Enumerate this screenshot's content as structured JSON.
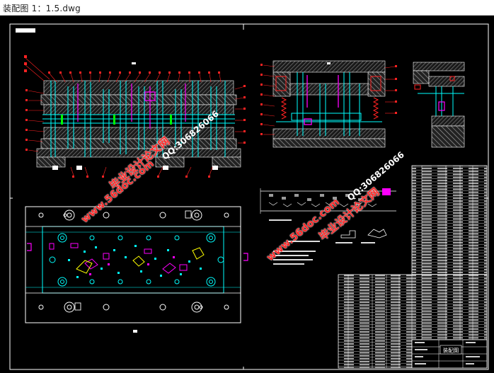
{
  "window": {
    "title": "装配图 1：1.5.dwg"
  },
  "title_block": {
    "name": "装配图"
  },
  "watermarks": {
    "site_1": "www.56doc.com",
    "qq_1": "QQ:306826066",
    "brand_1": "毕业设计论文网",
    "site_2": "www.56doc.com",
    "qq_2": "QQ:306826066",
    "brand_2": "毕业设计论文网"
  },
  "colors": {
    "background": "#000000",
    "frame": "#ffffff",
    "cyan": "#00ffff",
    "red": "#ff0000",
    "magenta": "#ff00ff",
    "yellow": "#ffff00",
    "green": "#00ff00",
    "hatch": "#8a8a8a"
  }
}
